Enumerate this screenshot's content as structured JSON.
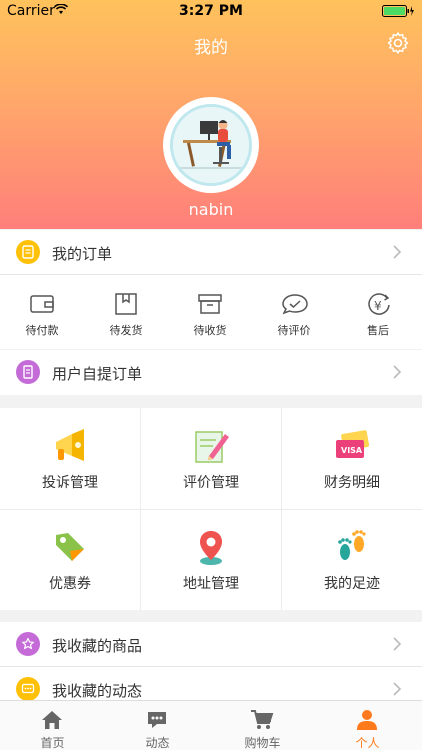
{
  "status": {
    "carrier": "Carrier",
    "time": "3:27 PM"
  },
  "header": {
    "title": "我的",
    "username": "nabin"
  },
  "my_orders": {
    "label": "我的订单"
  },
  "order_states": [
    {
      "label": "待付款",
      "icon": "wallet-icon"
    },
    {
      "label": "待发货",
      "icon": "box-icon"
    },
    {
      "label": "待收货",
      "icon": "package-receive-icon"
    },
    {
      "label": "待评价",
      "icon": "comment-check-icon"
    },
    {
      "label": "售后",
      "icon": "yen-refund-icon"
    }
  ],
  "pickup_orders": {
    "label": "用户自提订单"
  },
  "services": [
    {
      "label": "投诉管理",
      "icon": "megaphone-icon"
    },
    {
      "label": "评价管理",
      "icon": "pencil-note-icon"
    },
    {
      "label": "财务明细",
      "icon": "cards-icon"
    },
    {
      "label": "优惠券",
      "icon": "tag-icon"
    },
    {
      "label": "地址管理",
      "icon": "location-pin-icon"
    },
    {
      "label": "我的足迹",
      "icon": "footprints-icon"
    }
  ],
  "favorites_goods": {
    "label": "我收藏的商品"
  },
  "favorites_posts": {
    "label": "我收藏的动态"
  },
  "tabbar": {
    "items": [
      {
        "label": "首页",
        "icon": "home-icon"
      },
      {
        "label": "动态",
        "icon": "chat-icon"
      },
      {
        "label": "购物车",
        "icon": "cart-icon"
      },
      {
        "label": "个人",
        "icon": "person-icon"
      }
    ],
    "active_index": 3
  },
  "colors": {
    "accent": "#ff7a1a",
    "header_top": "#ffc25c",
    "header_bottom": "#ff7f7a"
  }
}
